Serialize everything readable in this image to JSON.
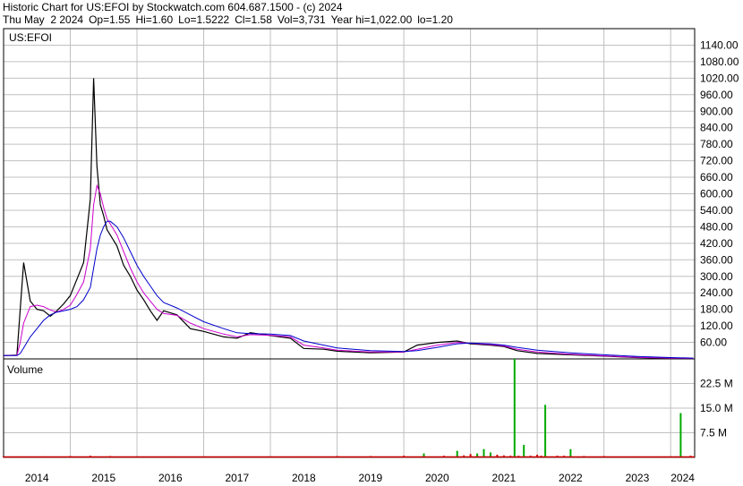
{
  "header": {
    "title": "Historic Chart for US:EFOI by Stockwatch.com 604.687.1500 - (c) 2024",
    "date": "Thu May  2 2024",
    "open": "Op=1.55",
    "high": "Hi=1.60",
    "low": "Lo=1.5222",
    "close": "Cl=1.58",
    "volume": "Vol=3,731",
    "year_high": "Year hi=1,022.00",
    "year_low": "lo=1.20"
  },
  "colors": {
    "price": "#000000",
    "ma_short": "#cc00cc",
    "ma_long": "#0000cc",
    "volume": "#00aa00",
    "volume_down": "#cc0000",
    "grid": "#c0c0c0"
  },
  "chart_data": [
    {
      "type": "line",
      "symbol": "US:EFOI",
      "ylim": [
        0,
        1200
      ],
      "y_ticks": [
        "60.00",
        "120.00",
        "180.00",
        "240.00",
        "300.00",
        "360.00",
        "420.00",
        "480.00",
        "540.00",
        "600.00",
        "660.00",
        "720.00",
        "780.00",
        "840.00",
        "900.00",
        "960.00",
        "1020.00",
        "1080.00",
        "1140.00"
      ],
      "x_ticks": [
        "2014",
        "2015",
        "2016",
        "2017",
        "2018",
        "2019",
        "2020",
        "2021",
        "2022",
        "2023",
        "2024"
      ],
      "grid": true,
      "series": [
        {
          "x": [
            2014.0,
            2014.2,
            2014.25,
            2014.3,
            2014.4,
            2014.5,
            2014.6,
            2014.7,
            2014.8,
            2014.9,
            2015.0,
            2015.1,
            2015.2,
            2015.3,
            2015.35,
            2015.4,
            2015.45,
            2015.5,
            2015.55,
            2015.6,
            2015.7,
            2015.8,
            2015.9,
            2016.0,
            2016.1,
            2016.2,
            2016.3,
            2016.4,
            2016.6,
            2016.8,
            2017.0,
            2017.3,
            2017.5,
            2017.7,
            2018.0,
            2018.3,
            2018.5,
            2018.8,
            2019.0,
            2019.5,
            2020.0,
            2020.2,
            2020.5,
            2020.8,
            2021.0,
            2021.3,
            2021.5,
            2021.7,
            2022.0,
            2022.5,
            2023.0,
            2023.5,
            2024.0,
            2024.34
          ],
          "values": [
            12,
            14,
            180,
            350,
            210,
            180,
            175,
            155,
            175,
            200,
            230,
            290,
            350,
            580,
            1020,
            700,
            560,
            520,
            470,
            450,
            410,
            340,
            300,
            250,
            215,
            175,
            140,
            175,
            160,
            110,
            100,
            80,
            75,
            95,
            85,
            75,
            38,
            35,
            28,
            22,
            25,
            50,
            60,
            65,
            55,
            50,
            45,
            30,
            20,
            15,
            10,
            5,
            2,
            1.58
          ]
        },
        {
          "values": [
            12,
            13,
            60,
            130,
            190,
            195,
            190,
            178,
            170,
            180,
            195,
            235,
            280,
            400,
            560,
            630,
            600,
            550,
            510,
            490,
            450,
            390,
            330,
            280,
            240,
            210,
            180,
            165,
            158,
            130,
            110,
            90,
            80,
            88,
            86,
            80,
            50,
            40,
            32,
            25,
            25,
            35,
            50,
            60,
            57,
            52,
            47,
            35,
            25,
            17,
            11,
            6,
            3,
            2
          ]
        },
        {
          "values": [
            12,
            12,
            20,
            40,
            80,
            110,
            140,
            160,
            170,
            175,
            180,
            190,
            215,
            260,
            330,
            400,
            450,
            480,
            500,
            500,
            480,
            440,
            390,
            340,
            300,
            265,
            230,
            205,
            185,
            160,
            135,
            110,
            95,
            92,
            90,
            85,
            65,
            50,
            40,
            30,
            27,
            30,
            42,
            55,
            58,
            55,
            50,
            42,
            32,
            22,
            15,
            9,
            5,
            3
          ]
        }
      ]
    },
    {
      "type": "bar",
      "title": "Volume",
      "ylim": [
        0,
        30
      ],
      "y_ticks": [
        "7.5 M",
        "15.0 M",
        "22.5 M"
      ],
      "x": [
        2014.0,
        2014.3,
        2014.6,
        2015.0,
        2015.3,
        2015.6,
        2016.0,
        2016.5,
        2017.0,
        2017.5,
        2018.0,
        2018.5,
        2019.0,
        2019.5,
        2020.0,
        2020.3,
        2020.6,
        2020.8,
        2020.9,
        2021.0,
        2021.1,
        2021.2,
        2021.3,
        2021.4,
        2021.5,
        2021.6,
        2021.66,
        2021.72,
        2021.8,
        2021.9,
        2022.0,
        2022.06,
        2022.12,
        2022.3,
        2022.4,
        2022.5,
        2022.7,
        2023.0,
        2023.5,
        2023.9,
        2024.0,
        2024.08,
        2024.15,
        2024.3
      ],
      "values": [
        0.3,
        0.3,
        0.3,
        0.4,
        0.5,
        0.4,
        0.3,
        0.3,
        0.3,
        0.3,
        0.3,
        0.3,
        0.4,
        0.4,
        0.5,
        1.2,
        0.5,
        2.0,
        0.6,
        1.0,
        1.2,
        2.5,
        1.5,
        0.8,
        0.6,
        0.5,
        30.0,
        0.5,
        3.8,
        0.5,
        0.8,
        0.5,
        16.0,
        0.5,
        0.5,
        2.5,
        0.4,
        0.4,
        0.3,
        0.3,
        0.3,
        0.3,
        13.5,
        0.5
      ]
    }
  ]
}
